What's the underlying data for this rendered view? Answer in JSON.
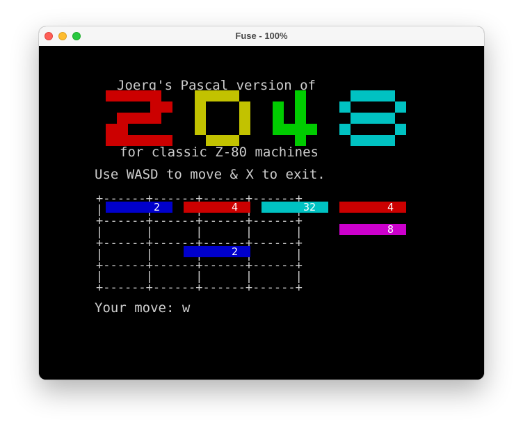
{
  "window": {
    "title": "Fuse - 100%"
  },
  "screen": {
    "header_line": "Joerg's Pascal version of",
    "logo_text": "2048",
    "logo_colors": [
      "#cc0000",
      "#c2c200",
      "#00cc00",
      "#00c2c2"
    ],
    "subtitle": "for classic Z-80 machines",
    "instructions": "Use WASD to move & X to exit.",
    "board": [
      [
        {
          "value": "2",
          "color": "#0000cc"
        },
        {
          "value": "4",
          "color": "#cc0000"
        },
        {
          "value": "32",
          "color": "#00c2c2"
        },
        {
          "value": "4",
          "color": "#cc0000"
        }
      ],
      [
        {
          "value": "",
          "color": ""
        },
        {
          "value": "",
          "color": ""
        },
        {
          "value": "",
          "color": ""
        },
        {
          "value": "8",
          "color": "#cc00cc"
        }
      ],
      [
        {
          "value": "",
          "color": ""
        },
        {
          "value": "2",
          "color": "#0000cc"
        },
        {
          "value": "",
          "color": ""
        },
        {
          "value": "",
          "color": ""
        }
      ],
      [
        {
          "value": "",
          "color": ""
        },
        {
          "value": "",
          "color": ""
        },
        {
          "value": "",
          "color": ""
        },
        {
          "value": "",
          "color": ""
        }
      ]
    ],
    "prompt": "Your move: w"
  }
}
